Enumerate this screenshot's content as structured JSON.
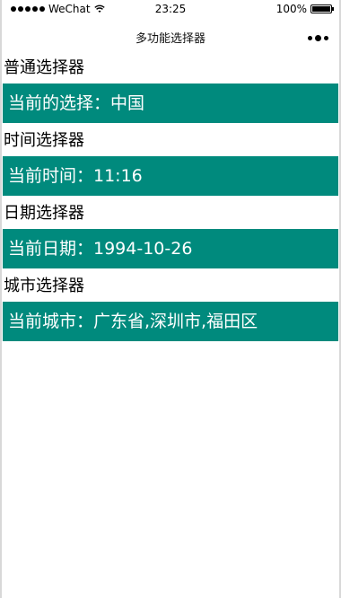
{
  "statusbar": {
    "carrier": "WeChat",
    "time": "23:25",
    "battery": "100%"
  },
  "navbar": {
    "title": "多功能选择器",
    "more_icon": "ellipsis-icon"
  },
  "sections": [
    {
      "title": "普通选择器",
      "value": "当前的选择：中国"
    },
    {
      "title": "时间选择器",
      "value": "当前时间：11:16"
    },
    {
      "title": "日期选择器",
      "value": "当前日期：1994-10-26"
    },
    {
      "title": "城市选择器",
      "value": "当前城市：广东省,深圳市,福田区"
    }
  ],
  "colors": {
    "picker_bg": "#008a7d",
    "picker_text": "#ffffff"
  }
}
